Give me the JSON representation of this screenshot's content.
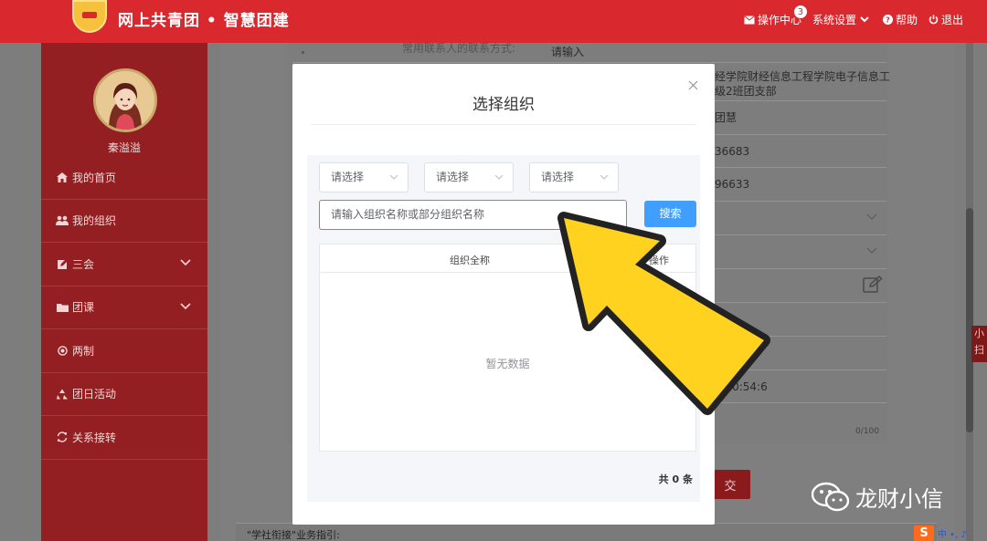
{
  "header": {
    "title": "网上共青团 • 智慧团建",
    "nav": [
      {
        "label": "操作中心",
        "icon": "envelope-icon",
        "badge": "3"
      },
      {
        "label": "系统设置",
        "icon": "chevron-down-icon"
      },
      {
        "label": "帮助",
        "icon": "question-circle-icon"
      },
      {
        "label": "退出",
        "icon": "power-icon"
      }
    ]
  },
  "sidebar": {
    "user_name": "秦溢溢",
    "items": [
      {
        "label": "我的首页",
        "icon": "home-icon"
      },
      {
        "label": "我的组织",
        "icon": "users-icon"
      },
      {
        "label": "三会",
        "icon": "edit-icon",
        "expandable": true
      },
      {
        "label": "团课",
        "icon": "folder-icon",
        "expandable": true
      },
      {
        "label": "两制",
        "icon": "circle-dot-icon"
      },
      {
        "label": "团日活动",
        "icon": "recycle-icon"
      },
      {
        "label": "关系接转",
        "icon": "refresh-icon"
      }
    ]
  },
  "background_form": {
    "contact_label": "常用联系人的联系方式:",
    "placeholder": "请输入",
    "org_text_1": "经学院财经信息工程学院电子信息工",
    "org_text_2": "级2班团支部",
    "name_fragment": "团慧",
    "phone_1": "36683",
    "phone_2": "96633",
    "datetime": "4 20:54:6",
    "counter": "0/100",
    "submit_fragment": "交",
    "guide_text": "\"学社衔接\"业务指引:",
    "side_tab": "小扫"
  },
  "modal": {
    "title": "选择组织",
    "selects": [
      "请选择",
      "请选择",
      "请选择"
    ],
    "search_placeholder": "请输入组织名称或部分组织名称",
    "search_button": "搜索",
    "table": {
      "columns": [
        "组织全称",
        "操作"
      ],
      "empty_text": "暂无数据"
    },
    "total": "共 0 条"
  },
  "watermark": {
    "text": "龙财小信",
    "ime_text": "中 •, ♪"
  },
  "colors": {
    "brand_red": "#d9282e",
    "sidebar_red": "#931f22",
    "primary_blue": "#409eff",
    "annotation_yellow": "#ffd21f"
  }
}
